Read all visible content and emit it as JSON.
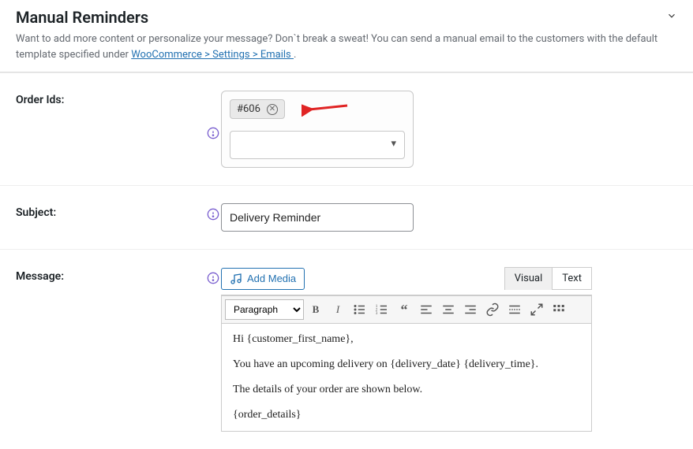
{
  "header": {
    "title": "Manual Reminders",
    "desc_before": "Want to add more content or personalize your message? Don`t break a sweat! You can send a manual email to the customers with the default template specified under ",
    "desc_link": "WooCommerce > Settings > Emails ",
    "desc_after": "."
  },
  "form": {
    "order_ids": {
      "label": "Order Ids:",
      "tag": "#606"
    },
    "subject": {
      "label": "Subject:",
      "value": "Delivery Reminder"
    },
    "message": {
      "label": "Message:",
      "add_media": "Add Media",
      "tab_visual": "Visual",
      "tab_text": "Text",
      "format_select": "Paragraph",
      "body_p1": "Hi {customer_first_name},",
      "body_p2": "You have an upcoming delivery on {delivery_date} {delivery_time}.",
      "body_p3": "The details of your order are shown below.",
      "body_p4": "{order_details}"
    }
  }
}
